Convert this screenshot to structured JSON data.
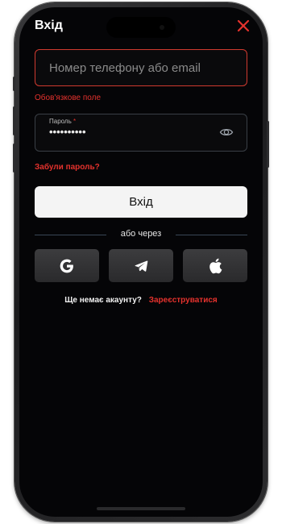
{
  "header": {
    "title": "Вхід",
    "close_icon": "close-icon"
  },
  "login_field": {
    "placeholder": "Номер телефону або email",
    "value": "",
    "error": "Обов'язкове поле"
  },
  "password_field": {
    "label": "Пароль",
    "required_mark": "*",
    "value_masked": "••••••••••",
    "toggle_icon": "eye-icon"
  },
  "forgot_password_label": "Забули пароль?",
  "submit_label": "Вхід",
  "divider_label": "або через",
  "social_buttons": [
    {
      "icon": "google-icon"
    },
    {
      "icon": "telegram-icon"
    },
    {
      "icon": "apple-icon"
    }
  ],
  "signup": {
    "question": "Ще немає акаунту?",
    "link_label": "Зареєструватися"
  },
  "colors": {
    "background": "#050507",
    "accent_red": "#e5322d",
    "error_border": "#d03a2f",
    "button_light": "#f4f4f4",
    "social_button": "#333335"
  }
}
